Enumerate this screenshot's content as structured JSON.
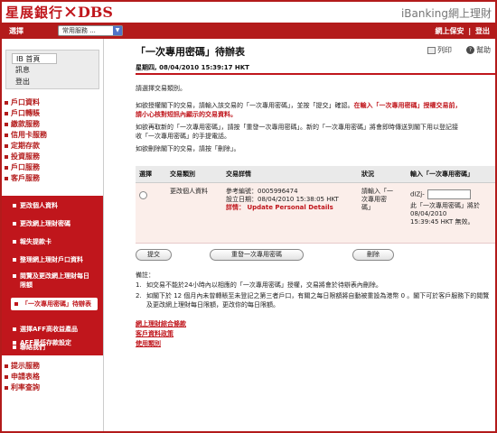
{
  "header": {
    "logo_zh": "星展銀行",
    "logo_en": "DBS",
    "app_title": "iBanking網上理財"
  },
  "topbar": {
    "label": "選擇",
    "service_select": "常用服務 ...",
    "secure_mail": "網上保安",
    "separator": "|",
    "logout": "登出"
  },
  "sidebar": {
    "grey_items": [
      "IB 首頁",
      "訊息",
      "登出"
    ],
    "main_items": [
      "戶口資料",
      "戶口轉賬",
      "繳款服務",
      "信用卡服務",
      "定期存款",
      "投資服務",
      "戶口服務",
      "客戶服務"
    ],
    "sub_items": [
      "更改個人資料",
      "更改網上理財密碼",
      "報失提款卡",
      "整理網上理財戶口資料",
      "閱覽及更改網上理財每日限額",
      "「一次專用密碼」待辦表",
      "選擇AFF高收益產品",
      "AFF最低存款設定",
      "聯絡我們"
    ],
    "bottom_items": [
      "提示服務",
      "申請表格",
      "利率查詢"
    ]
  },
  "main": {
    "title": "「一次專用密碼」待辦表",
    "datetime": "星期四, 08/04/2010 15:39:17 HKT",
    "print_label": "列印",
    "help_label": "幫助",
    "instruction": "請選擇交易類別。",
    "para1_a": "如欲授權閣下的交易，請輸入該交易的「一次專用密碼」，並按「提交」確認。",
    "para1_b": "在輸入「一次專用密碼」授權交易前，",
    "para1_c": "請小心核對短訊內顯示的交易資料。",
    "para2_a": "如欲再取新的「一次專用密碼」，請按「重發一次專用密碼」。新的「一次專用密碼」將會即時傳送到閣下用以登記接",
    "para2_b": "收「一次專用密碼」的手提電話。",
    "para3": "如欲刪除閣下的交易，請按「刪除」。"
  },
  "table": {
    "headers": [
      "選擇",
      "交易類別",
      "交易詳情",
      "狀況",
      "輸入「一次專用密碼」"
    ],
    "row": {
      "type": "更改個人資料",
      "ref_label": "參考編號：",
      "ref_value": "0005996474",
      "date_label": "設立日期：",
      "date_value": "08/04/2010 15:38:05 HKT",
      "detail_label": "詳情：",
      "detail_value": "Update Personal Details",
      "status_line1": "請輸入「一",
      "status_line2": "次專用密",
      "status_line3": "碼」",
      "pw_prefix": "dIZj-",
      "pw_value": "",
      "pw_note1": "此「一次專用密碼」將於",
      "pw_note2": "08/04/2010",
      "pw_note3": "15:39:45 HKT 無效。"
    }
  },
  "buttons": {
    "submit": "提交",
    "resend": "重發一次專用密碼",
    "delete": "刪除"
  },
  "notes": {
    "title": "備註：",
    "items": [
      {
        "n": "1.",
        "text": "如交易不能於24小時內以相應的「一次專用密碼」授權，交易將會於待辦表內刪除。"
      },
      {
        "n": "2.",
        "text": "如閣下於 12 個月內未曾轉賬至未登記之第三者戶口，有關之每日限額將自動被重設為港幣 0 。閣下可於客戶服務下的閱覽及更改網上理財每日限額，更改你的每日限額。"
      }
    ]
  },
  "footer_links": [
    "網上理財綜合條款",
    "客戶資料政策",
    "使用類別"
  ],
  "colors": {
    "brand_red": "#c0161c",
    "bar_red": "#b31b1b"
  }
}
